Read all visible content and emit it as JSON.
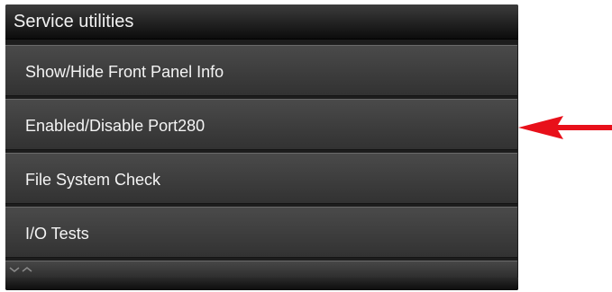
{
  "header": {
    "title": "Service utilities"
  },
  "menu": {
    "items": [
      {
        "label": "Show/Hide Front Panel Info"
      },
      {
        "label": "Enabled/Disable Port280"
      },
      {
        "label": "File System Check"
      },
      {
        "label": "I/O Tests"
      }
    ],
    "more_below": true
  },
  "annotation": {
    "icon": "red-arrow-left-icon",
    "points_to": "Enabled/Disable Port280",
    "color": "#e8101a"
  },
  "colors": {
    "panel_background": "#1d1d1d",
    "item_background": "#3e3e3e",
    "text": "#f4f4f4"
  }
}
